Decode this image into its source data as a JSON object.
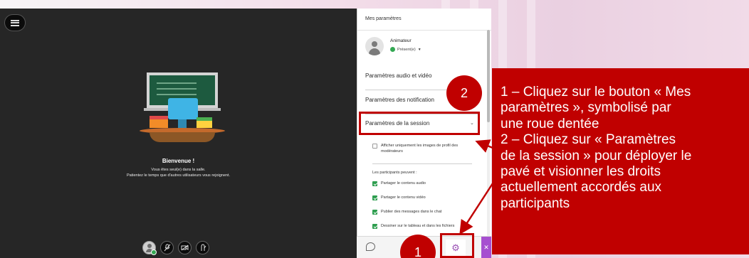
{
  "stage": {
    "welcome_title": "Bienvenue !",
    "welcome_line1": "Vous êtes seul(e) dans la salle.",
    "welcome_line2": "Patientez le temps que d'autres utilisateurs vous rejoignent."
  },
  "panel": {
    "title": "Mes paramètres",
    "user_role": "Animateur",
    "presence_status": "Présent(e)",
    "sections": {
      "audio_video": "Paramètres audio et vidéo",
      "notifications": "Paramètres des notification",
      "session": "Paramètres de la session"
    },
    "option_moderator_images": "Afficher uniquement les images de profil des modérateurs",
    "participants_label": "Les participants peuvent :",
    "permissions": [
      "Partager le contenu audio",
      "Partager le contenu vidéo",
      "Publier des messages dans le chat",
      "Dessiner sur le tableau et dans les fichiers"
    ]
  },
  "annotations": {
    "badge_1": "1",
    "badge_2": "2",
    "callout_lines": [
      "1 – Cliquez sur le bouton « Mes",
      "paramètres », symbolisé par",
      "une roue dentée",
      "2 – Cliquez sur « Paramètres",
      "de la session » pour déployer le",
      "pavé et visionner les droits",
      "actuellement accordés aux",
      "participants"
    ]
  },
  "colors": {
    "annotation_red": "#c00000",
    "accent_purple": "#a64fd0",
    "presence_green": "#34a853"
  },
  "icons": {
    "menu": "menu-icon",
    "chat": "chat-icon",
    "settings": "gear-icon",
    "close": "close-icon"
  }
}
